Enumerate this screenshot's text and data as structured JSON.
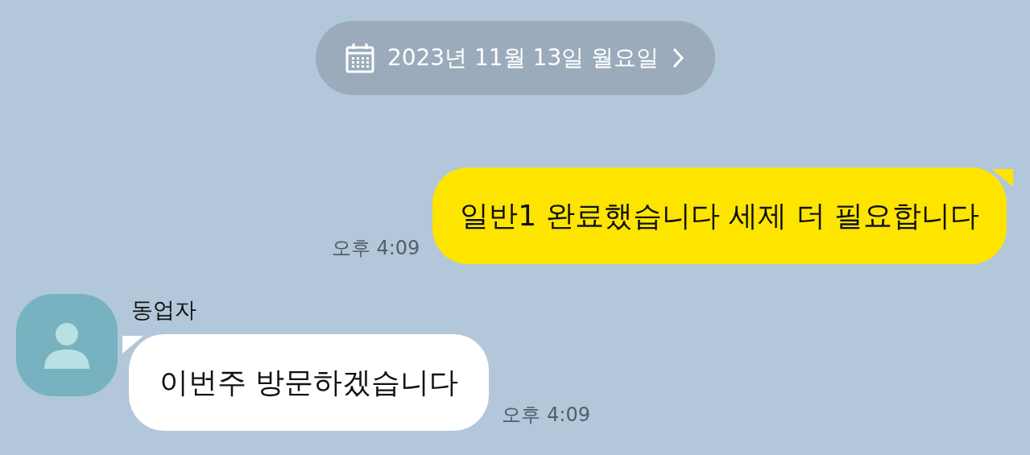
{
  "date_banner": {
    "text": "2023년 11월 13일 월요일"
  },
  "messages": [
    {
      "kind": "sent",
      "text": "일반1 완료했습니다 세제 더 필요합니다",
      "time": "오후 4:09"
    },
    {
      "kind": "received",
      "sender": "동업자",
      "text": "이번주 방문하겠습니다",
      "time": "오후 4:09"
    }
  ]
}
